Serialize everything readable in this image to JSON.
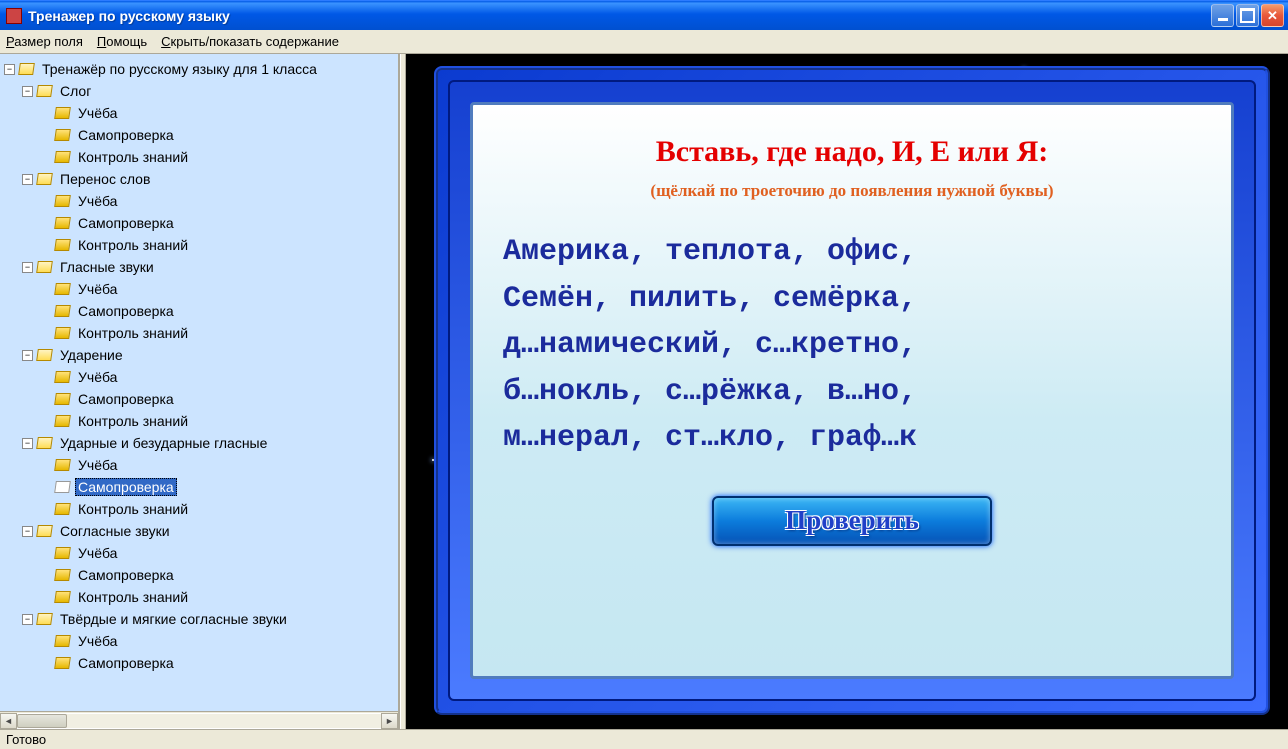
{
  "window": {
    "title": "Тренажер по русскому языку"
  },
  "menu": {
    "field_size": "Размер поля",
    "help": "Помощь",
    "toggle_toc": "Скрыть/показать содержание"
  },
  "tree": {
    "root": "Тренажёр по русскому языку для 1 класса",
    "topics": [
      "Слог",
      "Перенос слов",
      "Гласные звуки",
      "Ударение",
      "Ударные и безударные гласные",
      "Согласные звуки",
      "Твёрдые и мягкие согласные звуки"
    ],
    "sub": {
      "study": "Учёба",
      "selftest": "Самопроверка",
      "control": "Контроль знаний"
    },
    "selected_topic_index": 4,
    "selected_subitem": "selftest"
  },
  "task": {
    "title": "Вставь, где надо, И, Е или Я:",
    "hint": "(щёлкай по троеточию до появления нужной буквы)",
    "lines": [
      "Америка, теплота, офис,",
      "Семён, пилить, семёрка,",
      "д…намический, с…кретно,",
      "б…нокль, с…рёжка, в…но,",
      "м…нерал, ст…кло, граф…к"
    ],
    "check_button": "Проверить"
  },
  "status": {
    "text": "Готово"
  }
}
